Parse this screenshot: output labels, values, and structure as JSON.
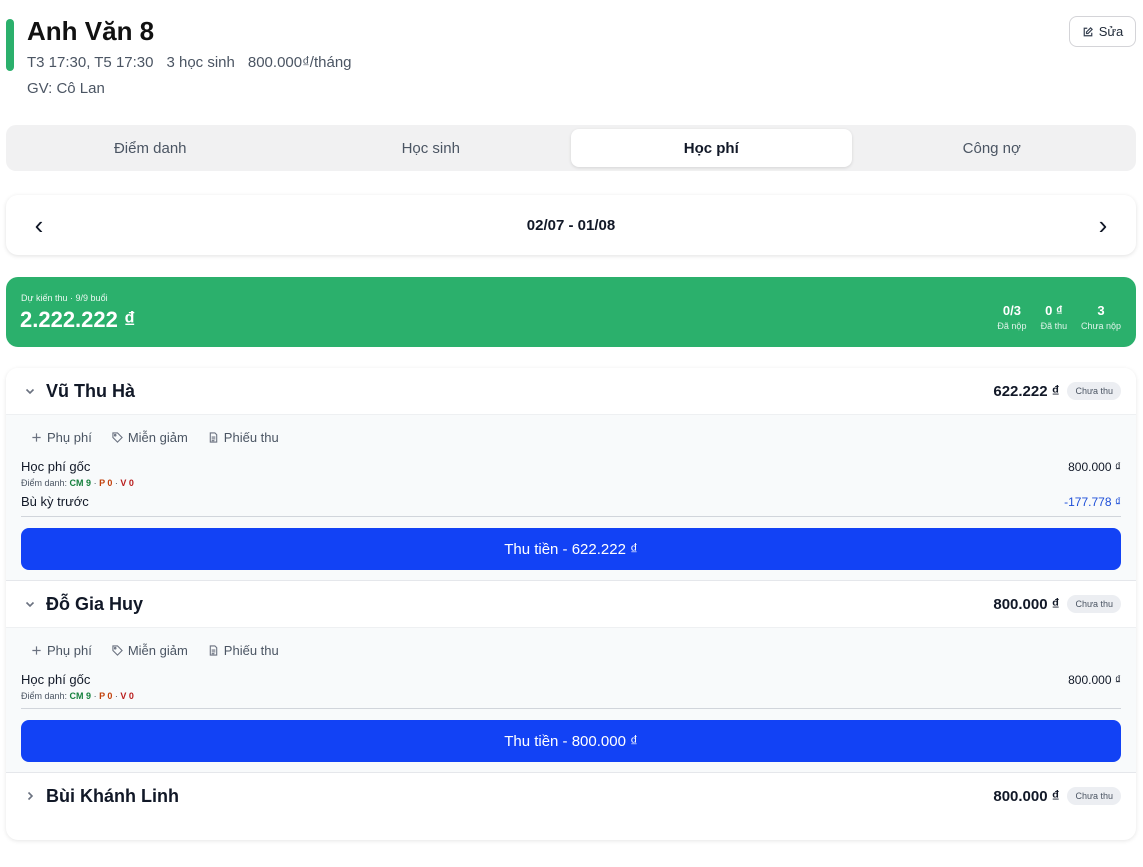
{
  "header": {
    "title": "Anh Văn 8",
    "schedule": "T3 17:30, T5 17:30",
    "student_count": "3 học sinh",
    "price": "800.000₫/tháng",
    "teacher": "GV: Cô Lan",
    "edit_label": "Sửa",
    "accent_color": "#2bb06c"
  },
  "tabs": [
    {
      "label": "Điểm danh",
      "active": false
    },
    {
      "label": "Học sinh",
      "active": false
    },
    {
      "label": "Học phí",
      "active": true
    },
    {
      "label": "Công nợ",
      "active": false
    }
  ],
  "period": {
    "prev": "‹",
    "next": "›",
    "range": "02/07 - 01/08"
  },
  "summary": {
    "caption": "Dự kiến thu · 9/9 buổi",
    "amount": "2.222.222 ₫",
    "stats": [
      {
        "value": "0/3",
        "label": "Đã nộp"
      },
      {
        "value": "0 ₫",
        "label": "Đã thu"
      },
      {
        "value": "3",
        "label": "Chưa nộp"
      }
    ],
    "color": "#2bb06c"
  },
  "students": [
    {
      "name": "Vũ Thu Hà",
      "total": "622.222 ₫",
      "status": "Chưa thu",
      "expanded": true,
      "actions": {
        "fee": "Phụ phí",
        "discount": "Miễn giảm",
        "receipt": "Phiếu thu"
      },
      "base_label": "Học phí gốc",
      "base_value": "800.000 ₫",
      "attendance_label": "Điểm danh:",
      "attendance": {
        "cm": "CM 9",
        "p": "P 0",
        "v": "V 0"
      },
      "adjust_label": "Bù kỳ trước",
      "adjust_value": "-177.778 ₫",
      "collect_label": "Thu tiền - 622.222 ₫"
    },
    {
      "name": "Đỗ Gia Huy",
      "total": "800.000 ₫",
      "status": "Chưa thu",
      "expanded": true,
      "actions": {
        "fee": "Phụ phí",
        "discount": "Miễn giảm",
        "receipt": "Phiếu thu"
      },
      "base_label": "Học phí gốc",
      "base_value": "800.000 ₫",
      "attendance_label": "Điểm danh:",
      "attendance": {
        "cm": "CM 9",
        "p": "P 0",
        "v": "V 0"
      },
      "collect_label": "Thu tiền - 800.000 ₫"
    },
    {
      "name": "Bùi Khánh Linh",
      "total": "800.000 ₫",
      "status": "Chưa thu",
      "expanded": false
    }
  ],
  "colors": {
    "primary_button": "#1242f5",
    "negative_adjust": "#1d4ed8"
  },
  "icons": {
    "edit": "pencil-square-icon",
    "plus": "plus-icon",
    "tag": "tag-icon",
    "receipt": "document-icon",
    "chevron_down": "chevron-down-icon",
    "chevron_right": "chevron-right-icon"
  }
}
